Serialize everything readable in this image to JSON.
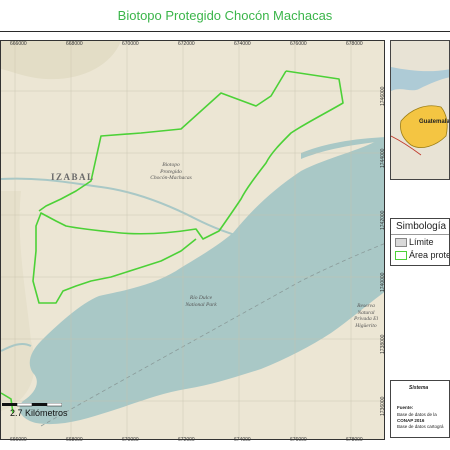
{
  "title": "Biotopo Protegido Chocón Machacas",
  "colors": {
    "protected_outline": "#4cd137",
    "water": "#a9c8c6",
    "land": "#ece6d4",
    "title_color": "#3bb54a"
  },
  "grid_labels": {
    "top": [
      "666000",
      "668000",
      "670000",
      "672000",
      "674000",
      "676000",
      "678000"
    ],
    "bottom": [
      "666000",
      "668000",
      "670000",
      "672000",
      "674000",
      "676000",
      "678000"
    ],
    "right": [
      "1746000",
      "1744000",
      "1742000",
      "1740000",
      "1738000",
      "1736000"
    ]
  },
  "map_labels": {
    "department": "IZABAL",
    "biotope": "Biotopo\nProtegido\nChocón-Machacas",
    "park": "Río Dulce\nNational Park",
    "reserve": "Reserva\nNatural\nPrivada El\nHigüerito"
  },
  "scale": {
    "text": "2.7 Kilómetros"
  },
  "legend": {
    "title": "Simbología",
    "items": [
      {
        "label": "Límite",
        "swatch": "#d9d9d9",
        "border": "#888888"
      },
      {
        "label": "Área protegida",
        "swatch": "#ffffff",
        "border": "#4cd137"
      }
    ]
  },
  "inset": {
    "label": "Guatemala"
  },
  "sources": {
    "header": "Sistema",
    "fuente": "Fuente:",
    "line1": "Base de datos de la",
    "line2": "CONAP 2016",
    "line3": "Base de datos cartográ"
  }
}
